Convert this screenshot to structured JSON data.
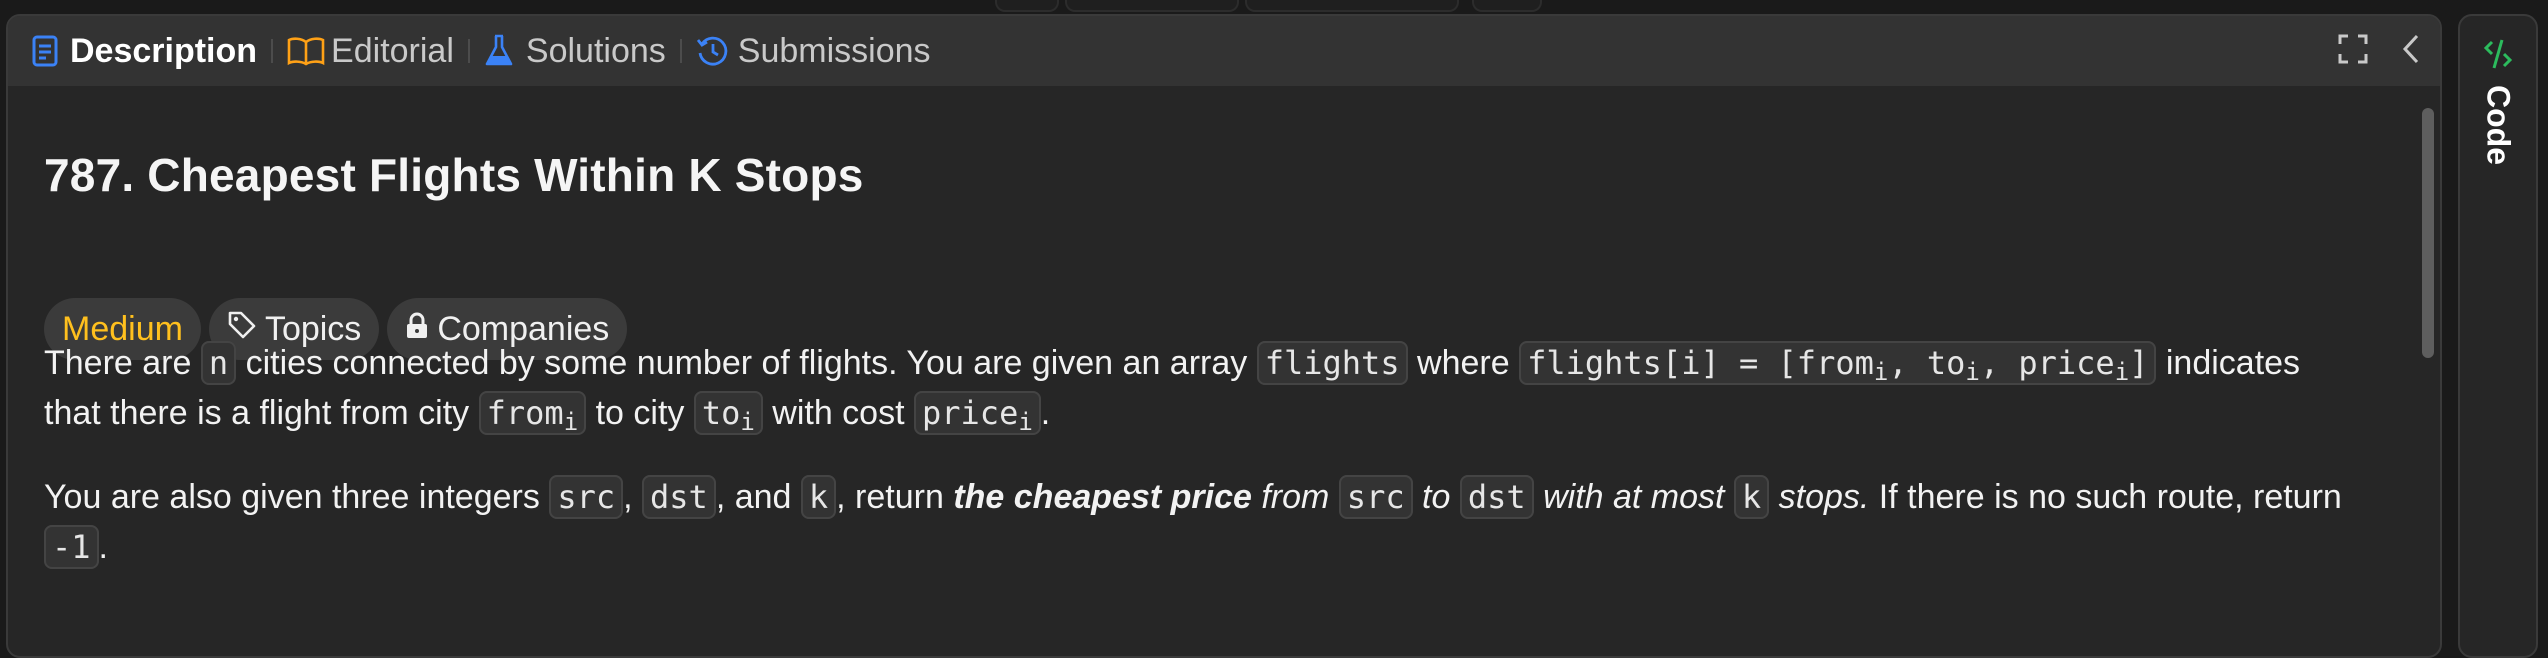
{
  "tabs": [
    {
      "label": "Description",
      "icon": "description-icon"
    },
    {
      "label": "Editorial",
      "icon": "book-icon"
    },
    {
      "label": "Solutions",
      "icon": "flask-icon"
    },
    {
      "label": "Submissions",
      "icon": "history-icon"
    }
  ],
  "problem": {
    "title": "787. Cheapest Flights Within K Stops",
    "difficulty": "Medium",
    "topics_label": "Topics",
    "companies_label": "Companies",
    "p1": {
      "t1": "There are ",
      "c_n": "n",
      "t2": " cities connected by some number of flights. You are given an array ",
      "c_flights": "flights",
      "t3": " where ",
      "c_expr_a": "flights[i] = [from",
      "sub_i": "i",
      "c_expr_b": ", to",
      "c_expr_c": ", price",
      "c_expr_d": "]",
      "t4": " indicates",
      "t5": "that there is a flight from city ",
      "c_from": "from",
      "t6": " to city ",
      "c_to": "to",
      "t7": " with cost ",
      "c_price": "price",
      "t8": "."
    },
    "p2": {
      "t1": "You are also given three integers ",
      "c_src": "src",
      "t2": ", ",
      "c_dst": "dst",
      "t3": ", and ",
      "c_k": "k",
      "t4": ", return ",
      "bold": "the cheapest price",
      "t5": " from ",
      "t6": " to ",
      "t7": " with at most ",
      "t8": " stops.",
      "t9": " If there is no such route, return",
      "c_neg": "-1",
      "t10": "."
    }
  },
  "side": {
    "code_label": "Code"
  },
  "colors": {
    "medium": "#ffc01e",
    "accent_blue": "#3b82f6",
    "code_green": "#2cbb5d"
  }
}
